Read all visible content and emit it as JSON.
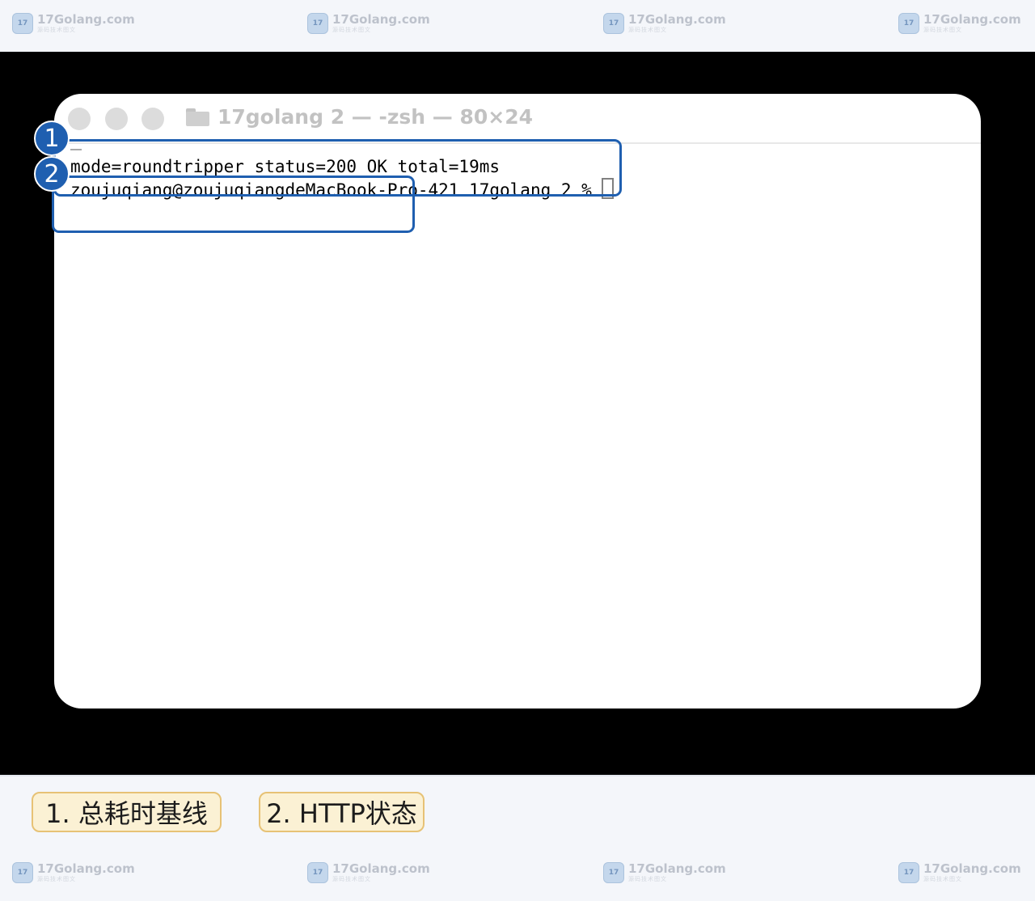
{
  "watermark": {
    "brand": "17Golang.com",
    "sub": "源码技术图文"
  },
  "terminal": {
    "window_title": "17golang 2 — -zsh — 80×24",
    "lines": [
      "mode=roundtripper status=200 OK total=19ms",
      "zoujuqiang@zoujuqiangdeMacBook-Pro-421 17golang 2 %"
    ]
  },
  "annotations": {
    "badges": [
      "1",
      "2"
    ],
    "legend": [
      "1. 总耗时基线",
      "2. HTTP状态"
    ],
    "accent_color": "#1f5fb0",
    "legend_bg": "#fbf1d4"
  },
  "icons": [
    "app-logo-icon",
    "folder-icon",
    "traffic-light-icon"
  ]
}
